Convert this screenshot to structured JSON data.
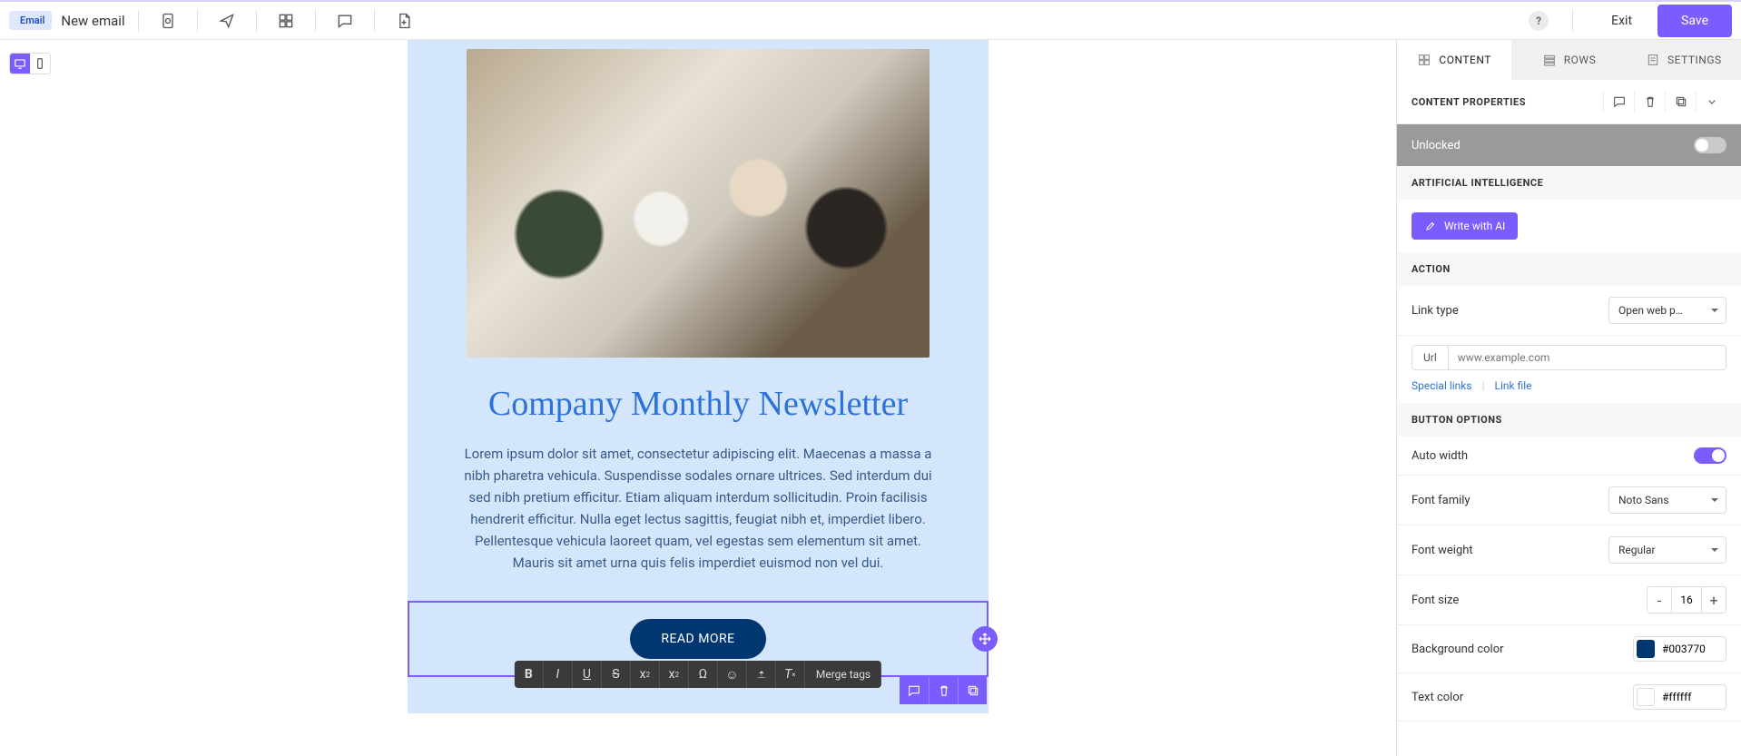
{
  "topbar": {
    "badge": "Email",
    "title": "New email",
    "exit": "Exit",
    "save": "Save"
  },
  "canvas": {
    "headline": "Company Monthly Newsletter",
    "body": "Lorem ipsum dolor sit amet, consectetur adipiscing elit. Maecenas a massa a nibh pharetra vehicula. Suspendisse sodales ornare ultrices. Sed interdum dui sed nibh pretium efficitur. Etiam aliquam interdum sollicitudin. Proin facilisis hendrerit efficitur. Nulla eget lectus sagittis, feugiat nibh et, imperdiet libero. Pellentesque vehicula laoreet quam, vel egestas sem elementum sit amet. Mauris sit amet urna quis felis imperdiet euismod non vel dui.",
    "button": "READ MORE",
    "toolbar_merge": "Merge tags"
  },
  "panel": {
    "tabs": {
      "content": "CONTENT",
      "rows": "ROWS",
      "settings": "SETTINGS"
    },
    "content_properties": "CONTENT PROPERTIES",
    "unlocked": "Unlocked",
    "ai_header": "ARTIFICIAL INTELLIGENCE",
    "ai_button": "Write with AI",
    "action_header": "ACTION",
    "link_type_label": "Link type",
    "link_type_value": "Open web p…",
    "url_label": "Url",
    "url_placeholder": "www.example.com",
    "special_links": "Special links",
    "link_file": "Link file",
    "button_options": "BUTTON OPTIONS",
    "auto_width": "Auto width",
    "font_family_label": "Font family",
    "font_family_value": "Noto Sans",
    "font_weight_label": "Font weight",
    "font_weight_value": "Regular",
    "font_size_label": "Font size",
    "font_size_value": "16",
    "bg_color_label": "Background color",
    "bg_color_value": "#003770",
    "text_color_label": "Text color",
    "text_color_value": "#ffffff"
  }
}
